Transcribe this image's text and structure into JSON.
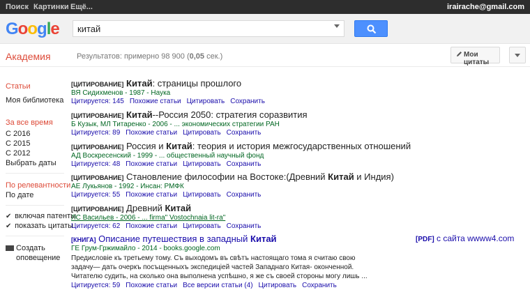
{
  "topbar": {
    "nav": [
      "Поиск",
      "Картинки",
      "Ещё..."
    ],
    "account": "irairache@gmail.com"
  },
  "logo": {
    "letters": [
      "G",
      "o",
      "o",
      "g",
      "l",
      "e"
    ]
  },
  "search": {
    "value": "китай"
  },
  "header": {
    "academy": "Академия",
    "results_prefix": "Результатов: примерно 98 900 (",
    "results_time": "0,05",
    "results_suffix": " сек.)",
    "my_citations": "Мои цитаты"
  },
  "sidebar": {
    "articles": "Статьи",
    "library": "Моя библиотека",
    "any_time": "За все время",
    "since_2016": "С 2016",
    "since_2015": "С 2015",
    "since_2012": "С 2012",
    "choose_dates": "Выбрать даты",
    "by_relevance": "По релевантности",
    "by_date": "По дате",
    "include_patents": "включая патенты",
    "show_citations": "показать цитаты",
    "create_alert_1": "Создать",
    "create_alert_2": "оповещение"
  },
  "results": [
    {
      "tag": "[ЦИТИРОВАНИЕ]",
      "title_before": "",
      "title_bold": "Китай",
      "title_after": ": страницы прошлого",
      "meta": "ВЯ Сидихменов - 1987 - Наука",
      "links": [
        "Цитируется: 145",
        "Похожие статьи",
        "Цитировать",
        "Сохранить"
      ]
    },
    {
      "tag": "[ЦИТИРОВАНИЕ]",
      "title_before": "",
      "title_bold": "Китай",
      "title_after": "--Россия 2050: стратегия соразвития",
      "meta": "Б Кузык, МЛ Титаренко - 2006 - ... экономических стратегии РАН",
      "links": [
        "Цитируется: 89",
        "Похожие статьи",
        "Цитировать",
        "Сохранить"
      ]
    },
    {
      "tag": "[ЦИТИРОВАНИЕ]",
      "title_before": "Россия и ",
      "title_bold": "Китай",
      "title_after": ": теория и история межгосударственных отношений",
      "meta": "АД Воскресенский - 1999 - ... общественный научный фонд",
      "links": [
        "Цитируется: 48",
        "Похожие статьи",
        "Цитировать",
        "Сохранить"
      ]
    },
    {
      "tag": "[ЦИТИРОВАНИЕ]",
      "title_before": "Становление философии на Востоке:(Древний ",
      "title_bold": "Китай",
      "title_after": " и Индия)",
      "meta": "АЕ Лукьянов - 1992 - Инсан: РМФК",
      "links": [
        "Цитируется: 55",
        "Похожие статьи",
        "Цитировать",
        "Сохранить"
      ]
    },
    {
      "tag": "[ЦИТИРОВАНИЕ]",
      "title_before": "Древний ",
      "title_bold": "Китай",
      "title_after": "",
      "meta": "ЛС Васильев - 2006 - ... firma\" Vostochnaia lit-ra\"",
      "links": [
        "Цитируется: 62",
        "Похожие статьи",
        "Цитировать",
        "Сохранить"
      ]
    },
    {
      "tag": "[КНИГА]",
      "title_before": "Описание путешествия в западный ",
      "title_bold": "Китай",
      "title_after": "",
      "meta": "ГЕ Грум-Гржимайло - 2014 - books.google.com",
      "snippet": "Предисловіе къ третьему тому. Съ выходомъ въ свѣтъ настоящаго тома я считаю свою задачу— дать очеркъ посъщенныхъ экспедиціей частей Западнаго Китая- оконченной. Читателю судить, на сколько она выполнена успѣшно, я же съ своей стороны могу лишь ...",
      "links": [
        "Цитируется: 59",
        "Похожие статьи",
        "Все версии статьи (4)",
        "Цитировать",
        "Сохранить"
      ],
      "pdf_tag": "[PDF]",
      "pdf_text": " с сайта wwww4.com"
    }
  ],
  "colors": {
    "link": "#1a0dab",
    "meta_green": "#006621",
    "accent_red": "#dd4b39",
    "search_button": "#4d90fe"
  }
}
